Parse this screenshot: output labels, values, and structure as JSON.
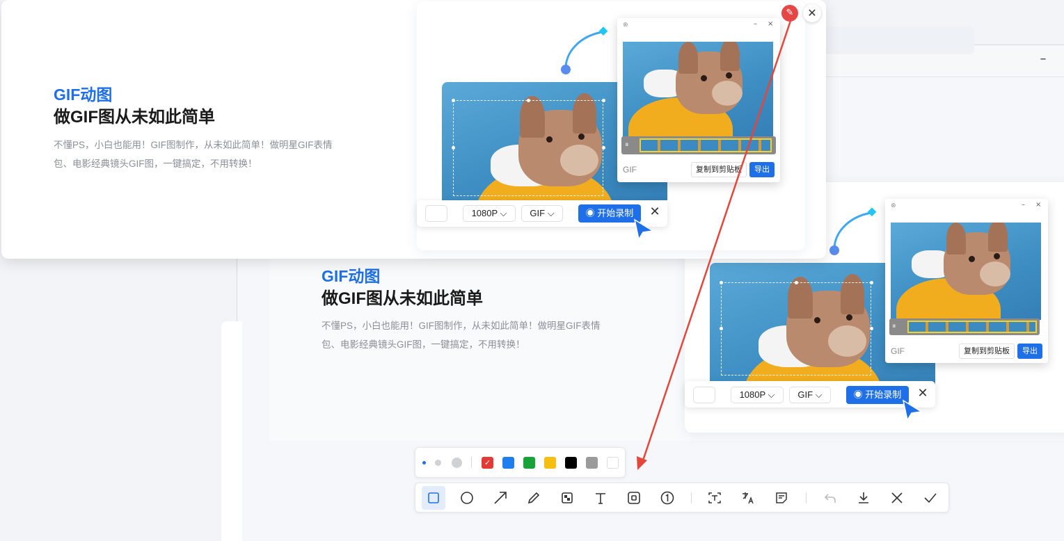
{
  "feature": {
    "tag": "GIF动图",
    "headline": "做GIF图从未如此简单",
    "description_line1": "不懂PS，小白也能用！GIF图制作，从未如此简单！做明星GIF表情",
    "description_line2": "包、电影经典镜头GIF图，一键搞定，不用转换！"
  },
  "recorder": {
    "resolution": "1080P",
    "format": "GIF",
    "start_label": "开始录制",
    "close_glyph": "✕"
  },
  "preview": {
    "window_min": "–",
    "window_close": "×",
    "format_label": "GIF",
    "copy_label": "复制到剪贴板",
    "export_label": "导出"
  },
  "annotation": {
    "edit_icon": "edit-icon",
    "close_glyph": "✕",
    "arrow_color": "#e5463b"
  },
  "back_window": {
    "minimize_glyph": "–"
  },
  "colors": {
    "accent": "#1e6fe8",
    "palette": [
      "#e23a35",
      "#1e7ef0",
      "#17a33a",
      "#f6be0f",
      "#000000",
      "#9a9a9a",
      "#ffffff"
    ]
  },
  "tools": [
    {
      "name": "rectangle-tool",
      "icon": "rectangle-icon",
      "active": true
    },
    {
      "name": "ellipse-tool",
      "icon": "circle-icon"
    },
    {
      "name": "arrow-tool",
      "icon": "arrow-icon"
    },
    {
      "name": "pen-tool",
      "icon": "pen-icon"
    },
    {
      "name": "mosaic-tool",
      "icon": "mosaic-icon"
    },
    {
      "name": "text-tool",
      "icon": "text-icon"
    },
    {
      "name": "blur-tool",
      "icon": "blur-icon"
    },
    {
      "name": "number-tool",
      "icon": "number-one-icon"
    },
    {
      "name": "ocr-tool",
      "icon": "ocr-text-icon"
    },
    {
      "name": "translate-tool",
      "icon": "translate-icon"
    },
    {
      "name": "note-tool",
      "icon": "note-icon"
    },
    {
      "name": "undo-button",
      "icon": "undo-icon"
    },
    {
      "name": "download-button",
      "icon": "download-icon"
    },
    {
      "name": "cancel-button",
      "icon": "close-icon"
    },
    {
      "name": "confirm-button",
      "icon": "check-icon"
    }
  ]
}
